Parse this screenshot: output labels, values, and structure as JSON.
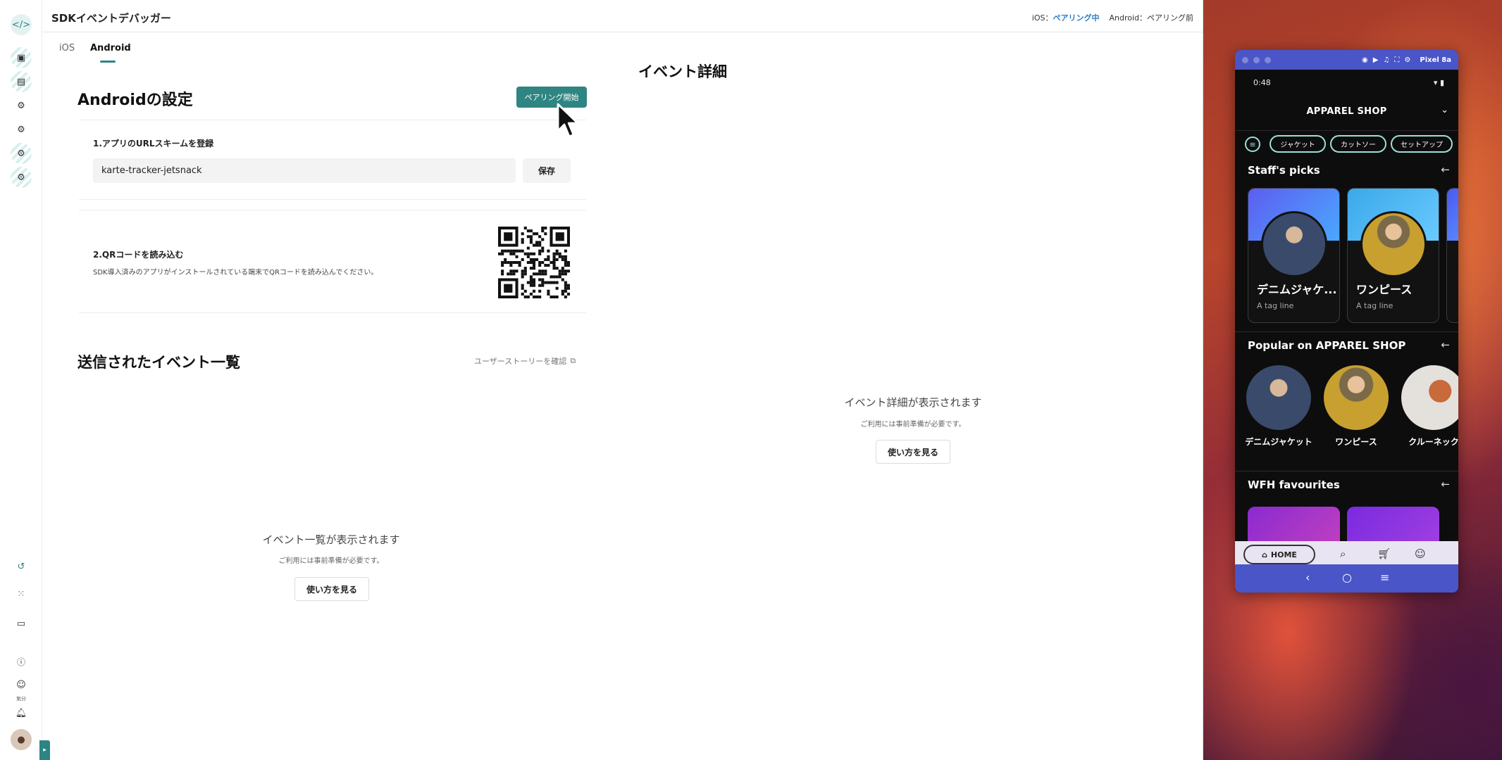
{
  "app": {
    "title": "SDKイベントデバッガー",
    "status": {
      "ios_label": "iOS：",
      "ios_value": "ペアリング中",
      "android_label": "Android：",
      "android_value": "ペアリング前"
    }
  },
  "rail": {
    "mood_label": "気分"
  },
  "tabs": [
    {
      "label": "iOS",
      "active": false
    },
    {
      "label": "Android",
      "active": true
    }
  ],
  "settings": {
    "title": "Androidの設定",
    "pairing_button": "ペアリング開始",
    "step1": {
      "label": "1.アプリのURLスキームを登録",
      "input_value": "karte-tracker-jetsnack",
      "save_button": "保存"
    },
    "step2": {
      "label": "2.QRコードを読み込む",
      "description": "SDK導入済みのアプリがインストールされている端末でQRコードを読み込んでください。"
    }
  },
  "events": {
    "title": "送信されたイベント一覧",
    "story_link": "ユーザーストーリーを確認",
    "empty_title": "イベント一覧が表示されます",
    "empty_desc": "ご利用には事前準備が必要です。",
    "howto_button": "使い方を見る"
  },
  "detail": {
    "title": "イベント詳細",
    "empty_title": "イベント詳細が表示されます",
    "empty_desc": "ご利用には事前準備が必要です。",
    "howto_button": "使い方を見る"
  },
  "emulator": {
    "device_name": "Pixel 8a",
    "phone": {
      "time": "0:48",
      "shop_name": "APPAREL SHOP",
      "chips": [
        "ジャケット",
        "カットソー",
        "セットアップ"
      ],
      "sections": {
        "staffs_picks": "Staff's picks",
        "popular": "Popular on APPAREL SHOP",
        "wfh": "WFH favourites"
      },
      "picks": [
        {
          "name": "デニムジャケ...",
          "tag": "A tag line"
        },
        {
          "name": "ワンピース",
          "tag": "A tag line"
        }
      ],
      "popular_items": [
        "デニムジャケット",
        "ワンピース",
        "クルーネック"
      ],
      "home_label": "HOME"
    }
  },
  "colors": {
    "accent": "#2f8582",
    "status_active": "#2a7fc4",
    "emulator_bar": "#4a55c8"
  }
}
